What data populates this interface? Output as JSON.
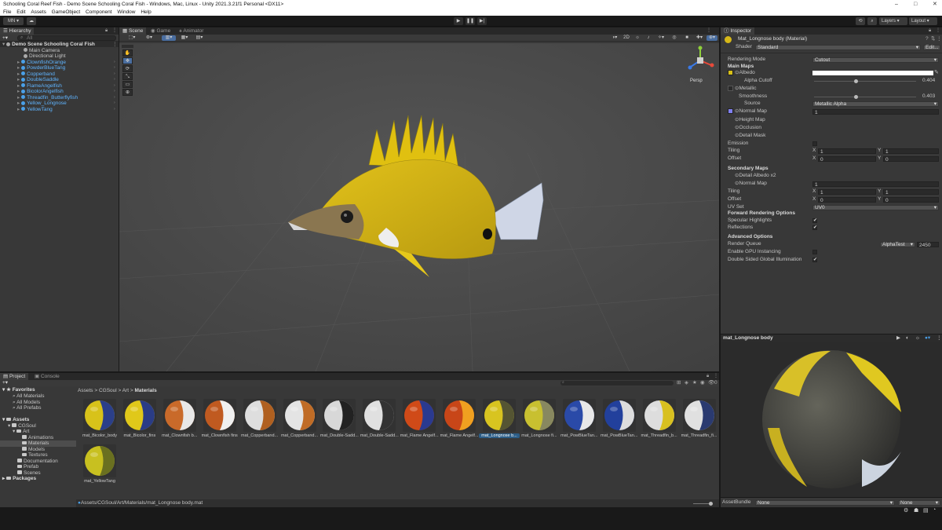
{
  "window": {
    "title": "Schooling Coral Reef Fish - Demo Scene Schooling Coral Fish - Windows, Mac, Linux - Unity 2021.3.21f1 Personal <DX11>",
    "min": "–",
    "max": "□",
    "close": "✕"
  },
  "menu": [
    "File",
    "Edit",
    "Assets",
    "GameObject",
    "Component",
    "Window",
    "Help"
  ],
  "toolbar": {
    "account": "MN",
    "play": "▶",
    "pause": "❚❚",
    "step": "▶|",
    "layers": "Layers",
    "layout": "Layout"
  },
  "hierarchy": {
    "tab": "Hierarchy",
    "search_placeholder": "All",
    "scene": "Demo Scene Schooling Coral Fish",
    "items": [
      "Main Camera",
      "Directional Light",
      "ClownfishOrange",
      "PowderBlueTang",
      "Copperband",
      "DoubleSaddle",
      "FlameAngelfish",
      "BicolorAngelfish",
      "Threadfin_Butterflyfish",
      "Yellow_Longnose",
      "YellowTang"
    ]
  },
  "scene": {
    "tabs": [
      "Scene",
      "Game",
      "Animator"
    ],
    "mode_2d": "2D",
    "persp": "Persp",
    "tools": [
      "✋",
      "✥",
      "⟳",
      "⤡",
      "▭",
      "⊕"
    ]
  },
  "inspector": {
    "tab": "Inspector",
    "material": "Mat_Longnose body (Material)",
    "shader_label": "Shader",
    "shader": "Standard",
    "edit": "Edit...",
    "rendering_mode_label": "Rendering Mode",
    "rendering_mode": "Cutout",
    "main_maps": "Main Maps",
    "albedo": "Albedo",
    "alpha_cutoff": "Alpha Cutoff",
    "alpha_cutoff_val": "0.404",
    "alpha_cutoff_frac": 0.404,
    "metallic": "Metallic",
    "smoothness": "Smoothness",
    "smoothness_val": "0.403",
    "smoothness_frac": 0.403,
    "source": "Source",
    "source_val": "Metallic Alpha",
    "normal_map": "Normal Map",
    "normal_val": "1",
    "height_map": "Height Map",
    "occlusion": "Occlusion",
    "detail_mask": "Detail Mask",
    "emission": "Emission",
    "tiling": "Tiling",
    "offset": "Offset",
    "x": "X",
    "y": "Y",
    "one": "1",
    "zero": "0",
    "secondary_maps": "Secondary Maps",
    "detail_albedo": "Detail Albedo x2",
    "normal_map2": "Normal Map",
    "normal2_val": "1",
    "uv_set": "UV Set",
    "uv_val": "UV0",
    "forward": "Forward Rendering Options",
    "specular": "Specular Highlights",
    "reflections": "Reflections",
    "advanced": "Advanced Options",
    "render_queue": "Render Queue",
    "rq_mode": "AlphaTest",
    "rq_val": "2450",
    "gpu": "Enable GPU Instancing",
    "dsgi": "Double Sided Global Illumination",
    "check": "✔"
  },
  "preview": {
    "title": "mat_Longnose body",
    "assetbundle": "AssetBundle",
    "none1": "None",
    "none2": "None"
  },
  "project": {
    "tabs": [
      "Project",
      "Console"
    ],
    "favorites": "Favorites",
    "fav_items": [
      "All Materials",
      "All Models",
      "All Prefabs"
    ],
    "assets": "Assets",
    "tree": [
      "CGSoul",
      "Art",
      "Animations",
      "Materials",
      "Models",
      "Textures",
      "Documentation",
      "Prefab",
      "Scenes"
    ],
    "packages": "Packages",
    "breadcrumb": [
      "Assets",
      "CGSoul",
      "Art",
      "Materials"
    ],
    "path": "Assets/CGSoul/Art/Materials/mat_Longnose body.mat",
    "count": "0",
    "thumbs": [
      "mat_Bicolor_body",
      "mat_Bicolor_fins",
      "mat_Clownfish b...",
      "mat_Clownfish fins",
      "mat_Copperband...",
      "mat_Copperband...",
      "mat_Double-Sadd...",
      "mat_Double-Sadd...",
      "mat_Flame Angelf...",
      "mat_Flame Angelf...",
      "mat_Longnose b...",
      "mat_Longnose fi...",
      "mat_PowBlueTan...",
      "mat_PowBlueTan...",
      "mat_Threadfin_b...",
      "mat_Threadfin_fi...",
      "mat_YellowTang"
    ],
    "thumb_colors": [
      [
        "#d8c21a",
        "#2b3f8a"
      ],
      [
        "#e0c81a",
        "#2a3c86"
      ],
      [
        "#c96a2a",
        "#e8e8e8"
      ],
      [
        "#c05a20",
        "#f0f0f0"
      ],
      [
        "#dedede",
        "#b06020"
      ],
      [
        "#e4e4e4",
        "#c06c26"
      ],
      [
        "#d8d8d8",
        "#222222"
      ],
      [
        "#e0e0e0",
        "#333333"
      ],
      [
        "#d04a18",
        "#2a3a90"
      ],
      [
        "#c84618",
        "#f0a020"
      ],
      [
        "#d8c420",
        "#555533"
      ],
      [
        "#c8c030",
        "#888860"
      ],
      [
        "#2a4aa8",
        "#e8e8e8"
      ],
      [
        "#22409c",
        "#dddddd"
      ],
      [
        "#dddddd",
        "#d8c020"
      ],
      [
        "#e0e0e0",
        "#2a3a70"
      ],
      [
        "#c8c020",
        "#6a7020"
      ]
    ]
  }
}
